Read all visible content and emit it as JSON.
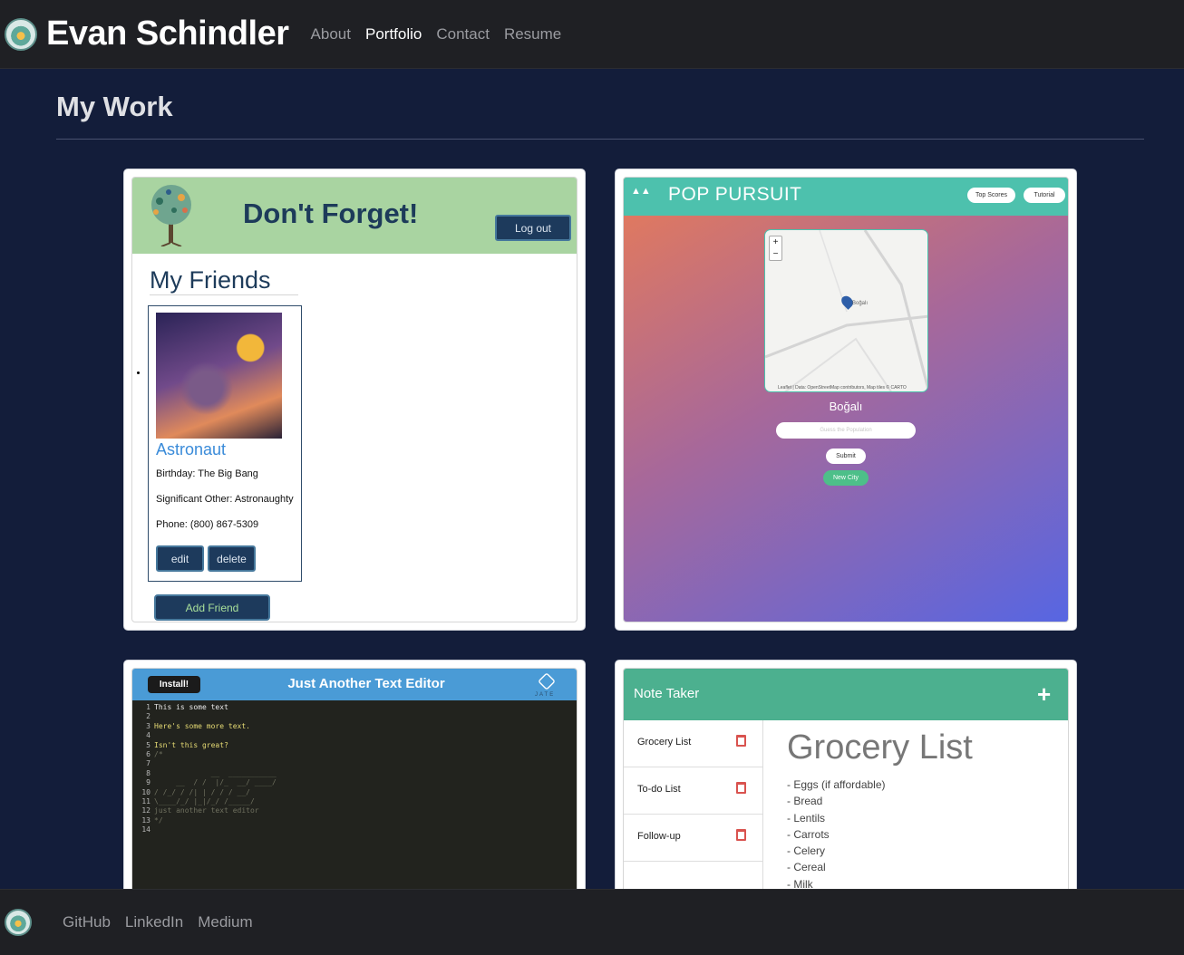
{
  "nav": {
    "brand": "Evan Schindler",
    "links": [
      "About",
      "Portfolio",
      "Contact",
      "Resume"
    ]
  },
  "section": {
    "title": "My Work"
  },
  "projects": {
    "dont_forget": {
      "title": "Don't Forget!",
      "logout": "Log out",
      "subtitle": "My Friends",
      "friend": {
        "name": "Astronaut",
        "birthday": "Birthday: The Big Bang",
        "significant_other": "Significant Other: Astronaughty",
        "phone": "Phone: (800) 867-5309"
      },
      "edit": "edit",
      "delete": "delete",
      "add": "Add Friend"
    },
    "pop_pursuit": {
      "title": "POP PURSUIT",
      "top_scores": "Top Scores",
      "tutorial": "Tutorial",
      "zoom_in": "+",
      "zoom_out": "−",
      "map_label": "Boğalı",
      "attribution": "Leaflet | Data: OpenStreetMap contributors, Map tiles © CARTO",
      "city": "Boğalı",
      "input_placeholder": "Guess the Population",
      "submit": "Submit",
      "new_city": "New City"
    },
    "jate": {
      "install": "Install!",
      "title": "Just Another Text Editor",
      "logo_text": "JATE",
      "lines": [
        {
          "n": "1",
          "text": "This is some text",
          "cls": "jate-t"
        },
        {
          "n": "2",
          "text": "",
          "cls": "jate-t"
        },
        {
          "n": "3",
          "text": "Here's some more text.",
          "cls": "jate-y"
        },
        {
          "n": "4",
          "text": "",
          "cls": "jate-t"
        },
        {
          "n": "5",
          "text": "Isn't this great?",
          "cls": "jate-y"
        },
        {
          "n": "6",
          "text": "/*",
          "cls": "jate-c"
        },
        {
          "n": "7",
          "text": "",
          "cls": "jate-c"
        },
        {
          "n": "8",
          "text": "             __  ___________",
          "cls": "jate-c"
        },
        {
          "n": "9",
          "text": "     __  / /  |/_  __/ ____/",
          "cls": "jate-c"
        },
        {
          "n": "10",
          "text": "/ /_/ / /| | / / / __/",
          "cls": "jate-c"
        },
        {
          "n": "11",
          "text": "\\____/_/ |_|/_/ /_____/",
          "cls": "jate-c"
        },
        {
          "n": "12",
          "text": "just another text editor",
          "cls": "jate-c"
        },
        {
          "n": "13",
          "text": "*/",
          "cls": "jate-c"
        },
        {
          "n": "14",
          "text": "",
          "cls": "jate-t"
        }
      ]
    },
    "note_taker": {
      "title": "Note Taker",
      "plus": "+",
      "notes": [
        "Grocery List",
        "To-do List",
        "Follow-up"
      ],
      "active_title": "Grocery List",
      "active_lines": [
        "- Eggs (if affordable)",
        "- Bread",
        "- Lentils",
        "- Carrots",
        "- Celery",
        "- Cereal",
        "- Milk"
      ]
    }
  },
  "footer": {
    "links": [
      "GitHub",
      "LinkedIn",
      "Medium"
    ]
  },
  "colors": {
    "page_bg": "#131d3a",
    "nav_bg": "#1f2024",
    "df_green": "#a9d4a1",
    "df_button": "#1d3a5c",
    "pp_teal": "#4dc1ad",
    "jate_blue": "#4a9bd6",
    "nt_green": "#4cb08f"
  }
}
